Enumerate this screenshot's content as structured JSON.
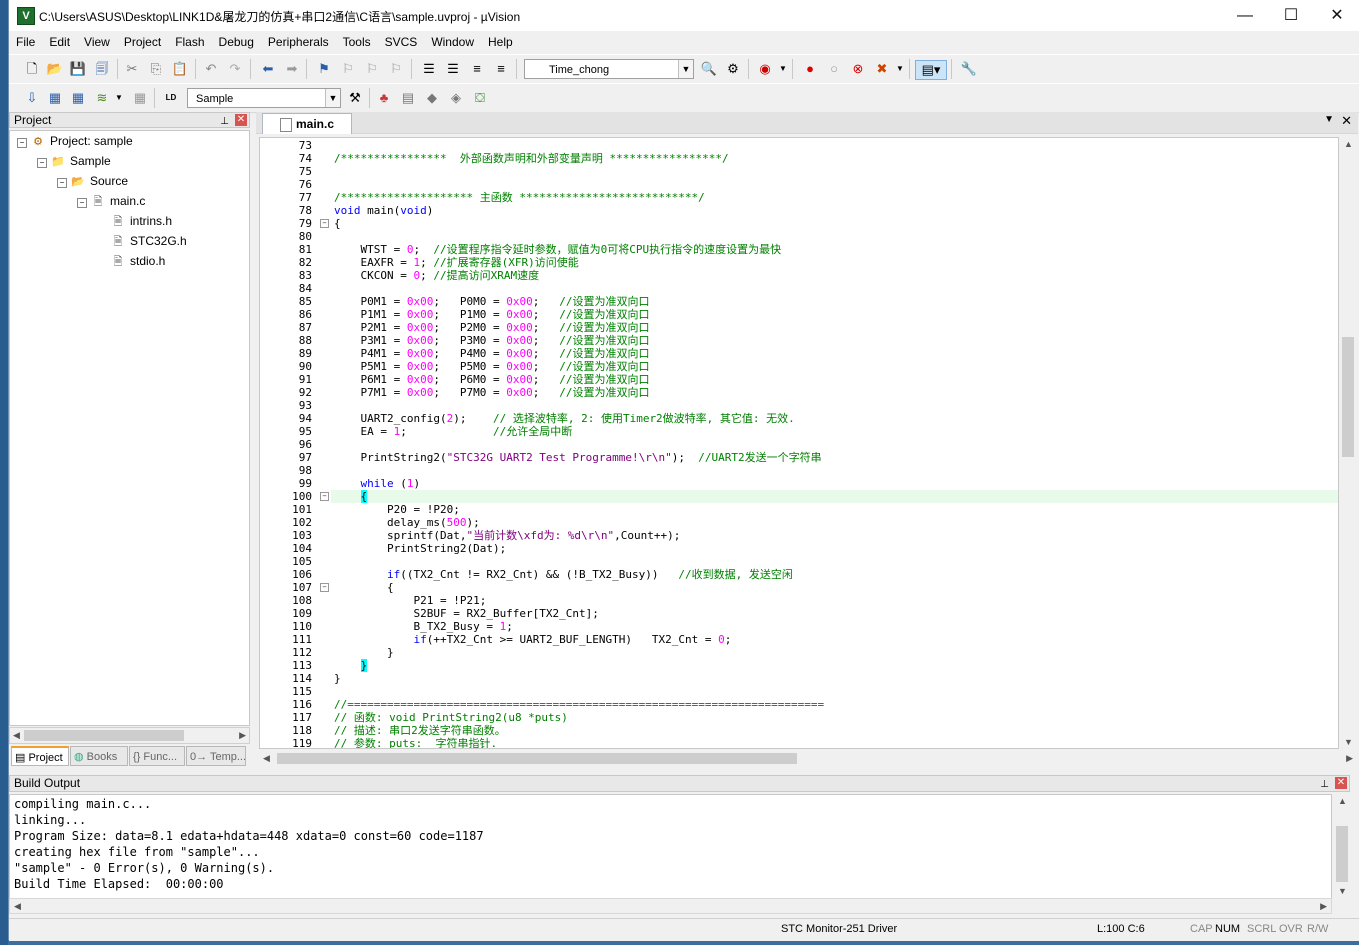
{
  "window": {
    "title": "C:\\Users\\ASUS\\Desktop\\LINK1D&屠龙刀的仿真+串口2通信\\C语言\\sample.uvproj - µVision",
    "minimize": "—",
    "maximize": "☐",
    "close": "✕"
  },
  "menu": [
    "File",
    "Edit",
    "View",
    "Project",
    "Flash",
    "Debug",
    "Peripherals",
    "Tools",
    "SVCS",
    "Window",
    "Help"
  ],
  "toolbar": {
    "find_combo_value": "Time_chong",
    "target_combo_value": "Sample"
  },
  "project_panel": {
    "title": "Project",
    "pin": "📌",
    "close": "✕",
    "tree": {
      "root": "Project: sample",
      "target": "Sample",
      "group": "Source",
      "file": "main.c",
      "includes": [
        "intrins.h",
        "STC32G.h",
        "stdio.h"
      ]
    },
    "tabs": [
      "Project",
      "Books",
      "{} Func...",
      "0→ Temp..."
    ]
  },
  "editor": {
    "tab": "main.c",
    "lines": [
      {
        "n": "73",
        "t": ""
      },
      {
        "n": "74",
        "t": "/****************  外部函数声明和外部变量声明 *****************/"
      },
      {
        "n": "75",
        "t": ""
      },
      {
        "n": "76",
        "t": ""
      },
      {
        "n": "77",
        "t": "/******************** 主函数 ***************************/"
      },
      {
        "n": "78",
        "t": "void main(void)"
      },
      {
        "n": "79",
        "t": "{"
      },
      {
        "n": "80",
        "t": ""
      },
      {
        "n": "81",
        "t": "    WTST = 0;  //设置程序指令延时参数，赋值为0可将CPU执行指令的速度设置为最快"
      },
      {
        "n": "82",
        "t": "    EAXFR = 1; //扩展寄存器(XFR)访问使能"
      },
      {
        "n": "83",
        "t": "    CKCON = 0; //提高访问XRAM速度"
      },
      {
        "n": "84",
        "t": ""
      },
      {
        "n": "85",
        "t": "    P0M1 = 0x00;   P0M0 = 0x00;   //设置为准双向口"
      },
      {
        "n": "86",
        "t": "    P1M1 = 0x00;   P1M0 = 0x00;   //设置为准双向口"
      },
      {
        "n": "87",
        "t": "    P2M1 = 0x00;   P2M0 = 0x00;   //设置为准双向口"
      },
      {
        "n": "88",
        "t": "    P3M1 = 0x00;   P3M0 = 0x00;   //设置为准双向口"
      },
      {
        "n": "89",
        "t": "    P4M1 = 0x00;   P4M0 = 0x00;   //设置为准双向口"
      },
      {
        "n": "90",
        "t": "    P5M1 = 0x00;   P5M0 = 0x00;   //设置为准双向口"
      },
      {
        "n": "91",
        "t": "    P6M1 = 0x00;   P6M0 = 0x00;   //设置为准双向口"
      },
      {
        "n": "92",
        "t": "    P7M1 = 0x00;   P7M0 = 0x00;   //设置为准双向口"
      },
      {
        "n": "93",
        "t": ""
      },
      {
        "n": "94",
        "t": "    UART2_config(2);    // 选择波特率, 2: 使用Timer2做波特率, 其它值: 无效."
      },
      {
        "n": "95",
        "t": "    EA = 1;             //允许全局中断"
      },
      {
        "n": "96",
        "t": ""
      },
      {
        "n": "97",
        "t": "    PrintString2(\"STC32G UART2 Test Programme!\\r\\n\");  //UART2发送一个字符串"
      },
      {
        "n": "98",
        "t": ""
      },
      {
        "n": "99",
        "t": "    while (1)"
      },
      {
        "n": "100",
        "t": "    {"
      },
      {
        "n": "101",
        "t": "        P20 = !P20;"
      },
      {
        "n": "102",
        "t": "        delay_ms(500);"
      },
      {
        "n": "103",
        "t": "        sprintf(Dat,\"当前计数\\xfd为: %d\\r\\n\",Count++);"
      },
      {
        "n": "104",
        "t": "        PrintString2(Dat);"
      },
      {
        "n": "105",
        "t": ""
      },
      {
        "n": "106",
        "t": "        if((TX2_Cnt != RX2_Cnt) && (!B_TX2_Busy))   //收到数据, 发送空闲"
      },
      {
        "n": "107",
        "t": "        {"
      },
      {
        "n": "108",
        "t": "            P21 = !P21;"
      },
      {
        "n": "109",
        "t": "            S2BUF = RX2_Buffer[TX2_Cnt];"
      },
      {
        "n": "110",
        "t": "            B_TX2_Busy = 1;"
      },
      {
        "n": "111",
        "t": "            if(++TX2_Cnt >= UART2_BUF_LENGTH)   TX2_Cnt = 0;"
      },
      {
        "n": "112",
        "t": "        }"
      },
      {
        "n": "113",
        "t": "    }"
      },
      {
        "n": "114",
        "t": "}"
      },
      {
        "n": "115",
        "t": ""
      },
      {
        "n": "116",
        "t": "//========================================================================"
      },
      {
        "n": "117",
        "t": "// 函数: void PrintString2(u8 *puts)"
      },
      {
        "n": "118",
        "t": "// 描述: 串口2发送字符串函数。"
      },
      {
        "n": "119",
        "t": "// 参数: puts:  字符串指针."
      }
    ]
  },
  "build_output": {
    "title": "Build Output",
    "pin": "📌",
    "close": "✕",
    "lines": [
      "compiling main.c...",
      "linking...",
      "Program Size: data=8.1 edata+hdata=448 xdata=0 const=60 code=1187",
      "creating hex file from \"sample\"...",
      "\"sample\" - 0 Error(s), 0 Warning(s).",
      "Build Time Elapsed:  00:00:00"
    ]
  },
  "statusbar": {
    "driver": "STC Monitor-251 Driver",
    "position": "L:100 C:6",
    "cap": "CAP",
    "num": "NUM",
    "scrl": "SCRL",
    "ovr": "OVR",
    "rw": "R/W"
  },
  "colors": {
    "comment": "#008000",
    "keyword": "#0000ff",
    "number": "#ff00ff",
    "string": "#800080",
    "current_line": "#e8fbea",
    "brace_match": "#00ffff"
  }
}
